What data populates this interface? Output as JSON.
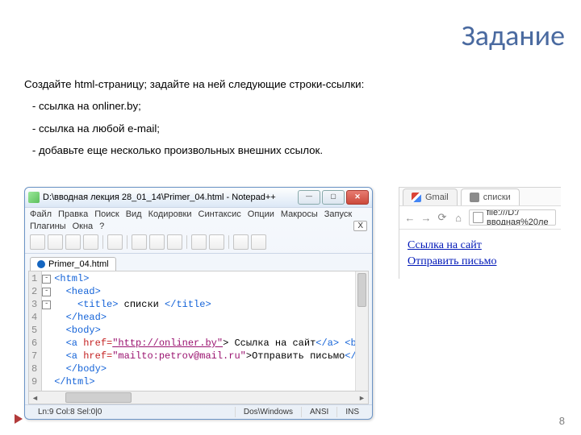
{
  "title": "Задание",
  "task": {
    "intro": "Создайте html-страницу; задайте на ней следующие строки-ссылки:",
    "items": [
      "ссылка на onliner.by;",
      "ссылка на любой e-mail;",
      " добавьте еще несколько произвольных внешних ссылок."
    ]
  },
  "npp": {
    "window_title": "D:\\вводная лекция 28_01_14\\Primer_04.html - Notepad++",
    "menus": [
      "Файл",
      "Правка",
      "Поиск",
      "Вид",
      "Кодировки",
      "Синтаксис",
      "Опции",
      "Макросы",
      "Запуск"
    ],
    "menus2": [
      "Плагины",
      "Окна",
      "?"
    ],
    "plugin_x": "X",
    "tab": "Primer_04.html",
    "lines": {
      "l1": "<html>",
      "l2": "<head>",
      "l3_open": "<title>",
      "l3_text": " списки ",
      "l3_close": "</title>",
      "l4": "</head>",
      "l5": "<body>",
      "l6_open": "<a ",
      "l6_attr": "href=",
      "l6_val": "\"http://onliner.by\"",
      "l6_mid": "> Ссылка на сайт",
      "l6_close": "</a>",
      "l6_br": " <br>",
      "l7_open": "<a ",
      "l7_attr": "href=",
      "l7_val": "\"mailto:petrov@mail.ru\"",
      "l7_mid": ">Отправить письмо",
      "l7_close": "</a>",
      "l8": "</body>",
      "l9": "</html>"
    },
    "line_numbers": [
      "1",
      "2",
      "3",
      "4",
      "5",
      "6",
      "7",
      "8",
      "9"
    ],
    "status": {
      "pos": "Ln:9   Col:8   Sel:0|0",
      "eol": "Dos\\Windows",
      "enc": "ANSI",
      "mode": "INS"
    }
  },
  "browser": {
    "tabs": [
      {
        "label": "Gmail",
        "favicon": "gmail-ico"
      },
      {
        "label": "списки",
        "favicon": "page-ico"
      }
    ],
    "url": "file:///D:/вводная%20ле",
    "links": [
      "Ссылка на сайт",
      "Отправить письмо"
    ]
  },
  "page_number": "8"
}
